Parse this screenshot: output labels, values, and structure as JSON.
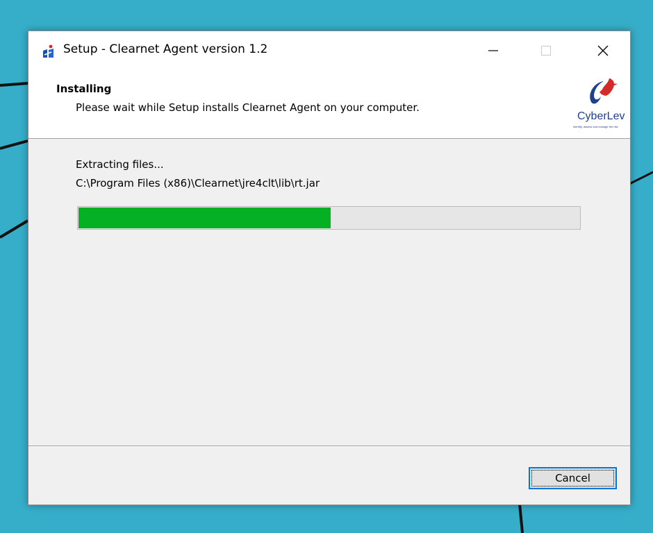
{
  "window": {
    "title": "Setup - Clearnet Agent version 1.2",
    "controls": {
      "minimize": "minimize-icon",
      "maximize": "maximize-icon",
      "close": "close-icon"
    }
  },
  "header": {
    "title": "Installing",
    "subtitle": "Please wait while Setup installs Clearnet Agent on your computer.",
    "logo": {
      "name": "CyberLev",
      "tagline": "Identify, assess and manage the risk"
    }
  },
  "status": {
    "action": "Extracting files...",
    "file_path": "C:\\Program Files (x86)\\Clearnet\\jre4clt\\lib\\rt.jar"
  },
  "progress": {
    "percent": 50.5,
    "color": "#06b025"
  },
  "footer": {
    "cancel_label": "Cancel"
  },
  "colors": {
    "desktop": "#36aec9",
    "accent": "#0078d7"
  }
}
